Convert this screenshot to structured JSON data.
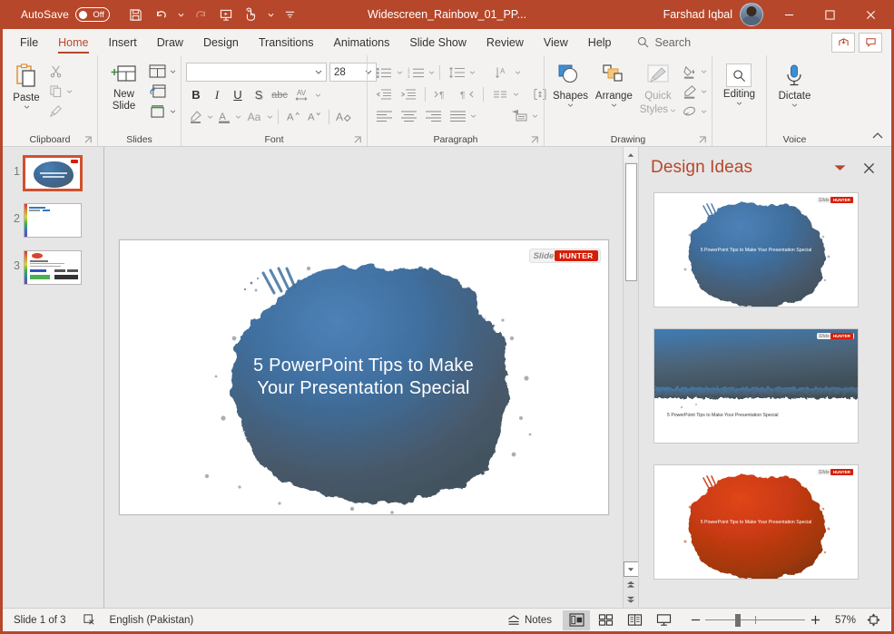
{
  "titlebar": {
    "autosave_label": "AutoSave",
    "autosave_state": "Off",
    "document_title": "Widescreen_Rainbow_01_PP...",
    "user_name": "Farshad Iqbal",
    "qat": [
      {
        "name": "save-icon",
        "label": "Save"
      },
      {
        "name": "undo-icon",
        "label": "Undo"
      },
      {
        "name": "redo-icon",
        "label": "Redo"
      },
      {
        "name": "start-presentation-icon",
        "label": "Start From Beginning"
      },
      {
        "name": "touch-mouse-mode-icon",
        "label": "Touch/Mouse Mode"
      },
      {
        "name": "customize-qat-icon",
        "label": "Customize Quick Access Toolbar"
      }
    ],
    "window": {
      "minimize": "Minimize",
      "maximize": "Maximize",
      "close": "Close"
    }
  },
  "tabs": [
    {
      "label": "File",
      "active": false
    },
    {
      "label": "Home",
      "active": true
    },
    {
      "label": "Insert",
      "active": false
    },
    {
      "label": "Draw",
      "active": false
    },
    {
      "label": "Design",
      "active": false
    },
    {
      "label": "Transitions",
      "active": false
    },
    {
      "label": "Animations",
      "active": false
    },
    {
      "label": "Slide Show",
      "active": false
    },
    {
      "label": "Review",
      "active": false
    },
    {
      "label": "View",
      "active": false
    },
    {
      "label": "Help",
      "active": false
    }
  ],
  "search": {
    "label": "Search",
    "placeholder": "Search"
  },
  "ribbon": {
    "groups": [
      {
        "label": "Clipboard"
      },
      {
        "label": "Slides"
      },
      {
        "label": "Font"
      },
      {
        "label": "Paragraph"
      },
      {
        "label": "Drawing"
      },
      {
        "label": "Voice"
      }
    ],
    "clipboard": {
      "paste": "Paste",
      "cut": "Cut",
      "copy": "Copy",
      "format_painter": "Format Painter"
    },
    "slides": {
      "new_slide": "New Slide",
      "layout": "Layout",
      "reset": "Reset",
      "section": "Section"
    },
    "font": {
      "font_name": "",
      "font_name_placeholder": "",
      "font_size": "28",
      "bold": "B",
      "italic": "I",
      "underline": "U",
      "shadow": "S",
      "strikethrough": "abc",
      "character_spacing": "AV",
      "text_highlight": "Text Highlight Color",
      "font_color": "Font Color",
      "change_case": "Aa",
      "increase_font_size": "A",
      "decrease_font_size": "A",
      "clear_formatting": "Clear All Formatting"
    },
    "paragraph": {
      "bullets": "Bullets",
      "numbering": "Numbering",
      "line_spacing": "Line Spacing",
      "text_direction_vertical": "Text Direction",
      "decrease_indent": "Decrease List Level",
      "increase_indent": "Increase List Level",
      "ltr": "Left-to-Right",
      "rtl": "Right-to-Left",
      "columns": "Columns",
      "align_text": "Align Text",
      "align_left": "Align Left",
      "align_center": "Center",
      "align_right": "Align Right",
      "justify": "Justify",
      "convert_smartart": "Convert to SmartArt"
    },
    "drawing": {
      "shapes": "Shapes",
      "arrange": "Arrange",
      "quick_styles": "Quick Styles",
      "shape_fill": "Shape Fill",
      "shape_outline": "Shape Outline",
      "shape_effects": "Shape Effects"
    },
    "editing": {
      "label": "Editing"
    },
    "voice": {
      "dictate": "Dictate"
    },
    "collapse": "Collapse the Ribbon"
  },
  "thumbnails": [
    {
      "number": "1",
      "selected": true,
      "style": "blue-blob"
    },
    {
      "number": "2",
      "selected": false,
      "style": "rainbow-bars"
    },
    {
      "number": "3",
      "selected": false,
      "style": "content-chart"
    }
  ],
  "slide": {
    "title": "5 PowerPoint Tips to Make Your Presentation Special",
    "title_line1": "5 PowerPoint Tips to Make",
    "title_line2": "Your Presentation Special",
    "logo_part1": "Slide",
    "logo_part2": "HUNTER",
    "blob_color": "#3b6ea5"
  },
  "design_pane": {
    "title": "Design Ideas",
    "collapse_label": "Collapse",
    "close_label": "Close",
    "cards": [
      {
        "style": "blue-blob",
        "caption": "5 PowerPoint Tips to Make Your Presentation Special",
        "color": "#3b6ea5"
      },
      {
        "style": "gradient-band",
        "caption": "5 PowerPoint Tips to Make Your Presentation Special",
        "color": "#3b6ea5"
      },
      {
        "style": "red-blob",
        "caption": "5 PowerPoint Tips to Make Your Presentation Special",
        "color": "#c2360f"
      }
    ]
  },
  "statusbar": {
    "slide_counter": "Slide 1 of 3",
    "accessibility_label": "Accessibility Checker",
    "language": "English (Pakistan)",
    "notes": "Notes",
    "views": [
      {
        "name": "normal-view",
        "label": "Normal",
        "active": true
      },
      {
        "name": "slide-sorter-view",
        "label": "Slide Sorter",
        "active": false
      },
      {
        "name": "reading-view",
        "label": "Reading View",
        "active": false
      },
      {
        "name": "slide-show-view",
        "label": "Slide Show",
        "active": false
      }
    ],
    "zoom_out": "Zoom Out",
    "zoom_in": "Zoom In",
    "zoom_level": "57%",
    "fit_slide": "Fit slide to current window"
  },
  "colors": {
    "accent": "#b7472a",
    "titlebar": "#b7472a",
    "ribbon_bg": "#f3f2f1",
    "canvas_bg": "#e6e6e6"
  }
}
